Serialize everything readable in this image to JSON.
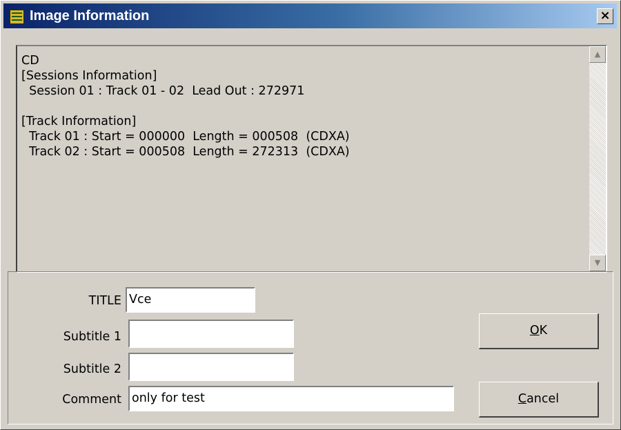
{
  "window": {
    "title": "Image Information",
    "close_label": "×"
  },
  "info": {
    "lines": [
      "CD",
      "[Sessions Information]",
      "  Session 01 : Track 01 - 02  Lead Out : 272971",
      "",
      "[Track Information]",
      "  Track 01 : Start = 000000  Length = 000508  (CDXA)",
      "  Track 02 : Start = 000508  Length = 272313  (CDXA)"
    ],
    "scroll_up_icon": "▲",
    "scroll_down_icon": "▼"
  },
  "form": {
    "title_label": "TITLE",
    "title_value": "Vce",
    "subtitle1_label": "Subtitle 1",
    "subtitle1_value": "",
    "subtitle2_label": "Subtitle 2",
    "subtitle2_value": "",
    "comment_label": "Comment",
    "comment_value": "only for test"
  },
  "buttons": {
    "ok_mnemonic": "O",
    "ok_rest": "K",
    "cancel_mnemonic": "C",
    "cancel_rest": "ancel"
  }
}
